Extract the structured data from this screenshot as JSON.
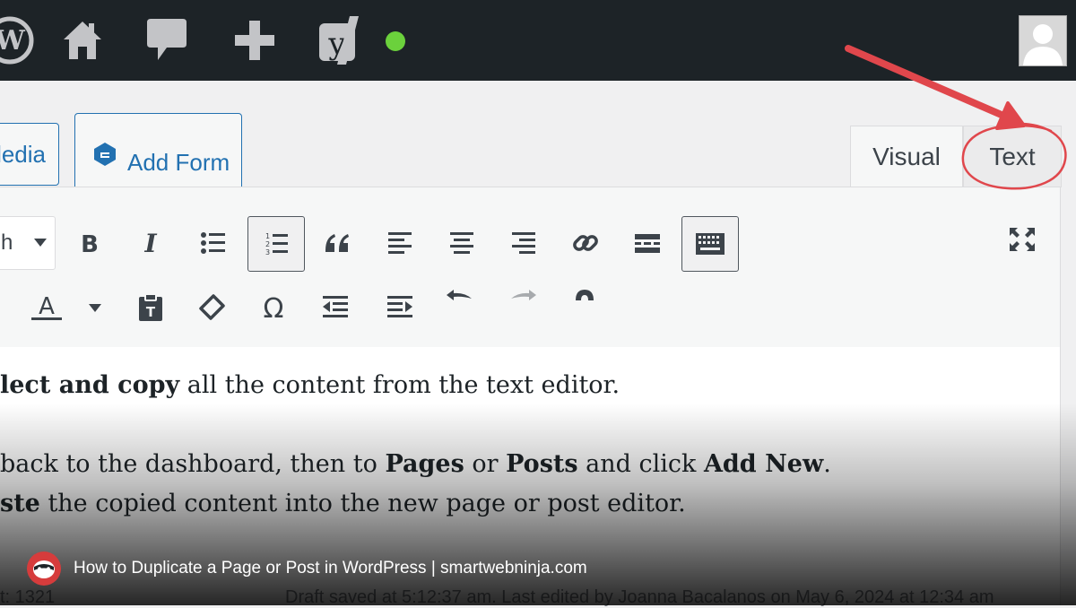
{
  "admin_bar": {
    "icons": [
      "wordpress-icon",
      "home-icon",
      "comment-icon",
      "plus-icon",
      "yoast-icon",
      "status-dot",
      "avatar"
    ]
  },
  "media_buttons": {
    "add_media_label": "ledia",
    "add_form_label": "Add Form"
  },
  "editor_tabs": {
    "visual": "Visual",
    "text": "Text"
  },
  "toolbar": {
    "format_select_value": "h",
    "row1": [
      "bold",
      "italic",
      "bullet-list",
      "numbered-list",
      "blockquote",
      "align-left",
      "align-center",
      "align-right",
      "link",
      "read-more",
      "toolbar-toggle",
      "fullscreen"
    ],
    "row2": [
      "text-color",
      "paste-text",
      "clear-formatting",
      "special-character",
      "outdent",
      "indent",
      "undo",
      "redo",
      "help"
    ]
  },
  "content": {
    "line1_bold": "lect and copy",
    "line1_rest": " all the content from the text editor.",
    "line2_a": " back to the dashboard, then to ",
    "line2_b": "Pages",
    "line2_c": " or ",
    "line2_d": "Posts",
    "line2_e": " and click ",
    "line2_f": "Add New",
    "line2_g": ".",
    "line3_bold": "ste",
    "line3_rest": " the copied content into the new page or post editor."
  },
  "status_bar": {
    "word_count": "t: 1321",
    "saved": "Draft saved at 5:12:37 am. Last edited by Joanna Bacalanos on May 6, 2024 at 12:34 am"
  },
  "caption": {
    "text": "How to Duplicate a Page or Post in WordPress | smartwebninja.com"
  },
  "colors": {
    "admin_bar": "#1d2327",
    "accent": "#2271b1",
    "annotation": "#e0474c",
    "status_dot": "#6bd13c"
  }
}
